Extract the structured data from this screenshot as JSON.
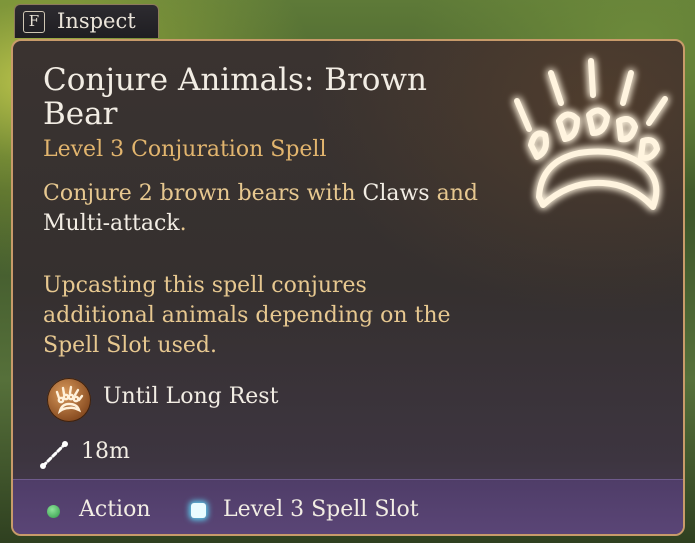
{
  "inspect": {
    "key": "F",
    "label": "Inspect"
  },
  "spell": {
    "title": "Conjure Animals: Brown Bear",
    "subtitle": "Level 3 Conjuration Spell",
    "description": {
      "part1": "Conjure 2 brown bears with ",
      "part2": "Claws",
      "part3": " and ",
      "part4": "Multi-attack",
      "part5": "."
    },
    "upcast": "Upcasting this spell conjures additional animals depending on the Spell Slot used.",
    "duration": "Until Long Rest",
    "range": "18m",
    "cost": {
      "action": "Action",
      "slot": "Level 3 Spell Slot"
    },
    "icons": {
      "art": "bear-paw-icon",
      "duration": "bear-paw-badge-icon",
      "range": "range-line-icon",
      "action": "action-dot-icon",
      "slot": "spell-slot-icon"
    }
  },
  "colors": {
    "title": "#f2ede4",
    "subtitle": "#e2b56e",
    "description": "#e7c890",
    "frame": "#c89b6a",
    "footer": "#5a4576",
    "action_dot": "#3fbf5a",
    "spell_slot": "#5ed0f0"
  }
}
